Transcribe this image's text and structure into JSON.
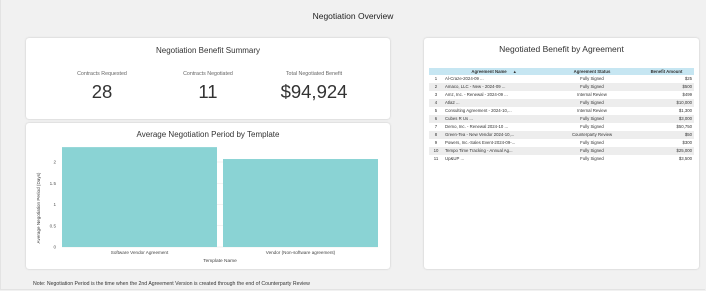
{
  "page_title": "Negotiation Overview",
  "summary_card": {
    "title": "Negotiation Benefit Summary",
    "kpis": [
      {
        "label": "Contracts Requested",
        "value": "28"
      },
      {
        "label": "Contracts Negotiated",
        "value": "11"
      },
      {
        "label": "Total Negotiated Benefit",
        "value": "$94,924"
      }
    ]
  },
  "chart_card": {
    "title": "Average Negotiation Period by Template"
  },
  "chart_data": {
    "type": "bar",
    "title": "Average Negotiation Period by Template",
    "categories": [
      "Software Vendor Agreement",
      "Vendor (Non-software agreement)"
    ],
    "values": [
      2.35,
      2.07
    ],
    "xlabel": "Template Name",
    "ylabel": "Average Negotiation Period (Days)",
    "ylim": [
      0,
      2.4
    ],
    "yticks": [
      "0",
      "0.5",
      "1",
      "1.5",
      "2"
    ],
    "grid": true,
    "bar_color": "#8ad3d4"
  },
  "table_card": {
    "title": "Negotiated Benefit by Agreement",
    "columns": [
      "Agreement Name",
      "Agreement Status",
      "Benefit Amount"
    ],
    "rows": [
      {
        "n": "1",
        "name": "Al-Craze-2024-09 ...",
        "status": "Fully Signed",
        "amount": "$25"
      },
      {
        "n": "2",
        "name": "Amaco, LLC - New - 2024-09 ...",
        "status": "Fully Signed",
        "amount": "$500"
      },
      {
        "n": "3",
        "name": "Amz, Inc. - Renewal - 2024-09 ...",
        "status": "Internal Review",
        "amount": "$499"
      },
      {
        "n": "4",
        "name": "Atla2 ...",
        "status": "Fully Signed",
        "amount": "$10,000"
      },
      {
        "n": "5",
        "name": "Consulting Agreement - 2024-10,...",
        "status": "Internal Review",
        "amount": "$1,300"
      },
      {
        "n": "6",
        "name": "Cubes R Us ...",
        "status": "Fully Signed",
        "amount": "$3,000"
      },
      {
        "n": "7",
        "name": "Demo, Inc. - Renewal 2024-10 ...",
        "status": "Fully Signed",
        "amount": "$50,750"
      },
      {
        "n": "8",
        "name": "Green-Tea - New Vendor 2024-10,...",
        "status": "Counterparty Review",
        "amount": "$50"
      },
      {
        "n": "9",
        "name": "Powers, Inc.-Sales Event-2024-09-...",
        "status": "Fully Signed",
        "amount": "$300"
      },
      {
        "n": "10",
        "name": "Tempo Time Tracking - Annual Ag...",
        "status": "Fully Signed",
        "amount": "$25,000"
      },
      {
        "n": "11",
        "name": "Up&UP ...",
        "status": "Fully Signed",
        "amount": "$3,500"
      }
    ]
  },
  "note": "Note: Negotiation Period is the time when the 2nd Agreement Version is created through the end of Counterparty Review",
  "icons": {
    "sort": "sort-ascending-icon"
  }
}
